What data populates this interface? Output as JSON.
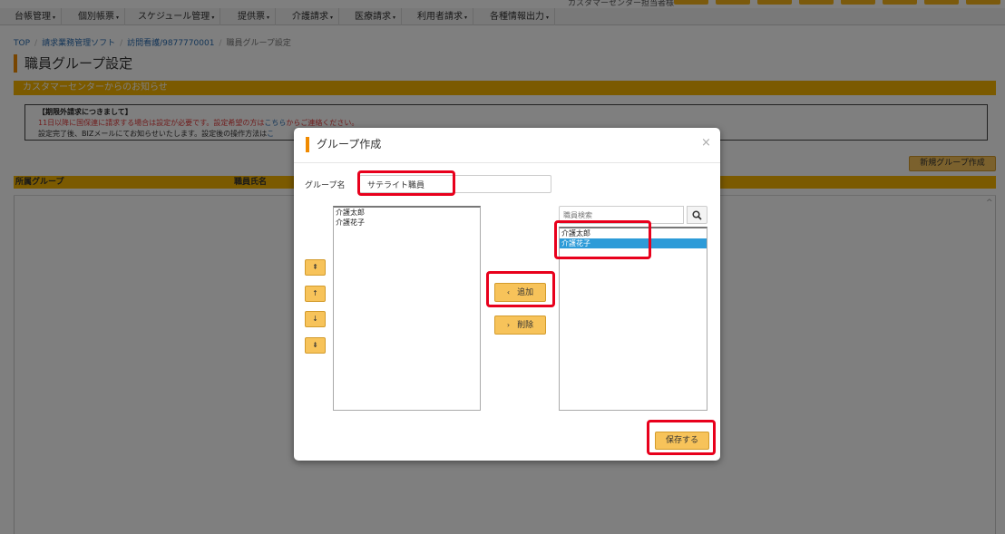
{
  "top_strip": {
    "center_label": "カスタマーセンター担当者様"
  },
  "nav": {
    "items": [
      {
        "label": "台帳管理"
      },
      {
        "label": "個別帳票"
      },
      {
        "label": "スケジュール管理"
      },
      {
        "label": "提供票"
      },
      {
        "label": "介護請求"
      },
      {
        "label": "医療請求"
      },
      {
        "label": "利用者請求"
      },
      {
        "label": "各種情報出力"
      }
    ],
    "caret": "▾"
  },
  "breadcrumb": {
    "top": "TOP",
    "software": "請求業務管理ソフト",
    "office": "訪問看護/9877770001",
    "current": "職員グループ設定",
    "separator": "/"
  },
  "page": {
    "title": "職員グループ設定"
  },
  "notice": {
    "bar_title": "カスタマーセンターからのお知らせ",
    "heading": "【期限外請求につきまして】",
    "line1_before": "11日以降に国保連に請求する場合は設定が必要です。設定希望の方は",
    "line1_link": "こちら",
    "line1_after": "からご連絡ください。",
    "line2_before": "設定完了後、BIZメールにてお知らせいたします。設定後の操作方法は",
    "line2_link": "こ"
  },
  "list": {
    "new_group_button": "新規グループ作成",
    "col_group": "所属グループ",
    "col_staff": "職員氏名",
    "scroll_up_glyph": "^"
  },
  "modal": {
    "title": "グループ作成",
    "close_glyph": "×",
    "group_name_label": "グループ名",
    "group_name_value": "サテライト職員",
    "left_list": [
      "介護太郎",
      "介護花子"
    ],
    "order_buttons": [
      "⇞",
      "↑",
      "↓",
      "⇟"
    ],
    "add_button": "追加",
    "add_chevron": "‹",
    "remove_button": "削除",
    "remove_chevron": "›",
    "search_placeholder": "職員検索",
    "search_icon_glyph": "🔍",
    "right_list": [
      "介護太郎",
      "介護花子"
    ],
    "right_selected_index": 1,
    "save_button": "保存する"
  },
  "colors": {
    "accent_orange": "#f08a00",
    "header_yellow": "#f7b500",
    "button_yellow": "#f7c35a",
    "highlight_red": "#e8001c",
    "selection_blue": "#2d9bd8"
  }
}
